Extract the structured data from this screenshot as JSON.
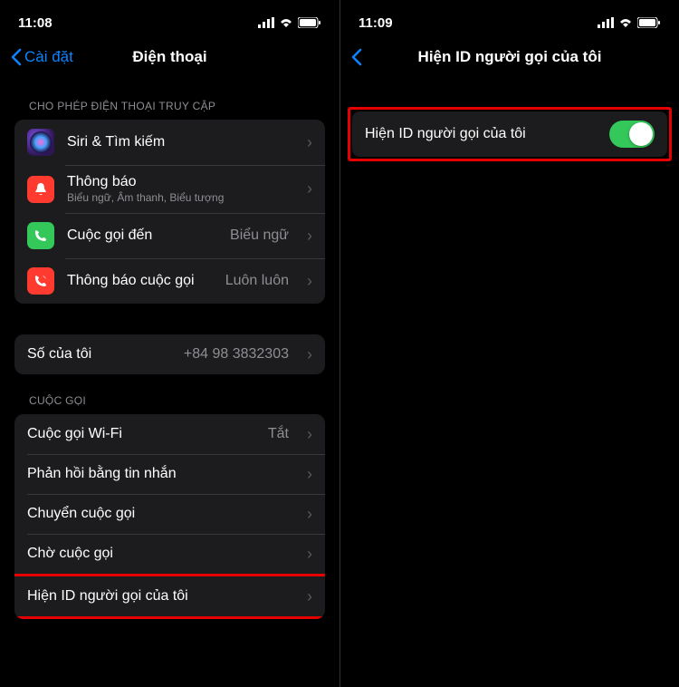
{
  "left": {
    "time": "11:08",
    "back_label": "Cài đặt",
    "title": "Điện thoại",
    "section_access": "CHO PHÉP ĐIỆN THOẠI TRUY CẬP",
    "rows_access": [
      {
        "label": "Siri & Tìm kiếm",
        "sub": ""
      },
      {
        "label": "Thông báo",
        "sub": "Biểu ngữ, Âm thanh, Biểu tượng"
      },
      {
        "label": "Cuộc gọi đến",
        "detail": "Biểu ngữ"
      },
      {
        "label": "Thông báo cuộc gọi",
        "detail": "Luôn luôn"
      }
    ],
    "my_number_label": "Số của tôi",
    "my_number_value": "+84 98 3832303",
    "section_calls": "CUỘC GỌI",
    "rows_calls": [
      {
        "label": "Cuộc gọi Wi-Fi",
        "detail": "Tắt"
      },
      {
        "label": "Phản hồi bằng tin nhắn",
        "detail": ""
      },
      {
        "label": "Chuyển cuộc gọi",
        "detail": ""
      },
      {
        "label": "Chờ cuộc gọi",
        "detail": ""
      },
      {
        "label": "Hiện ID người gọi của tôi",
        "detail": ""
      }
    ]
  },
  "right": {
    "time": "11:09",
    "title": "Hiện ID người gọi của tôi",
    "toggle_label": "Hiện ID người gọi của tôi",
    "toggle_on": true
  }
}
